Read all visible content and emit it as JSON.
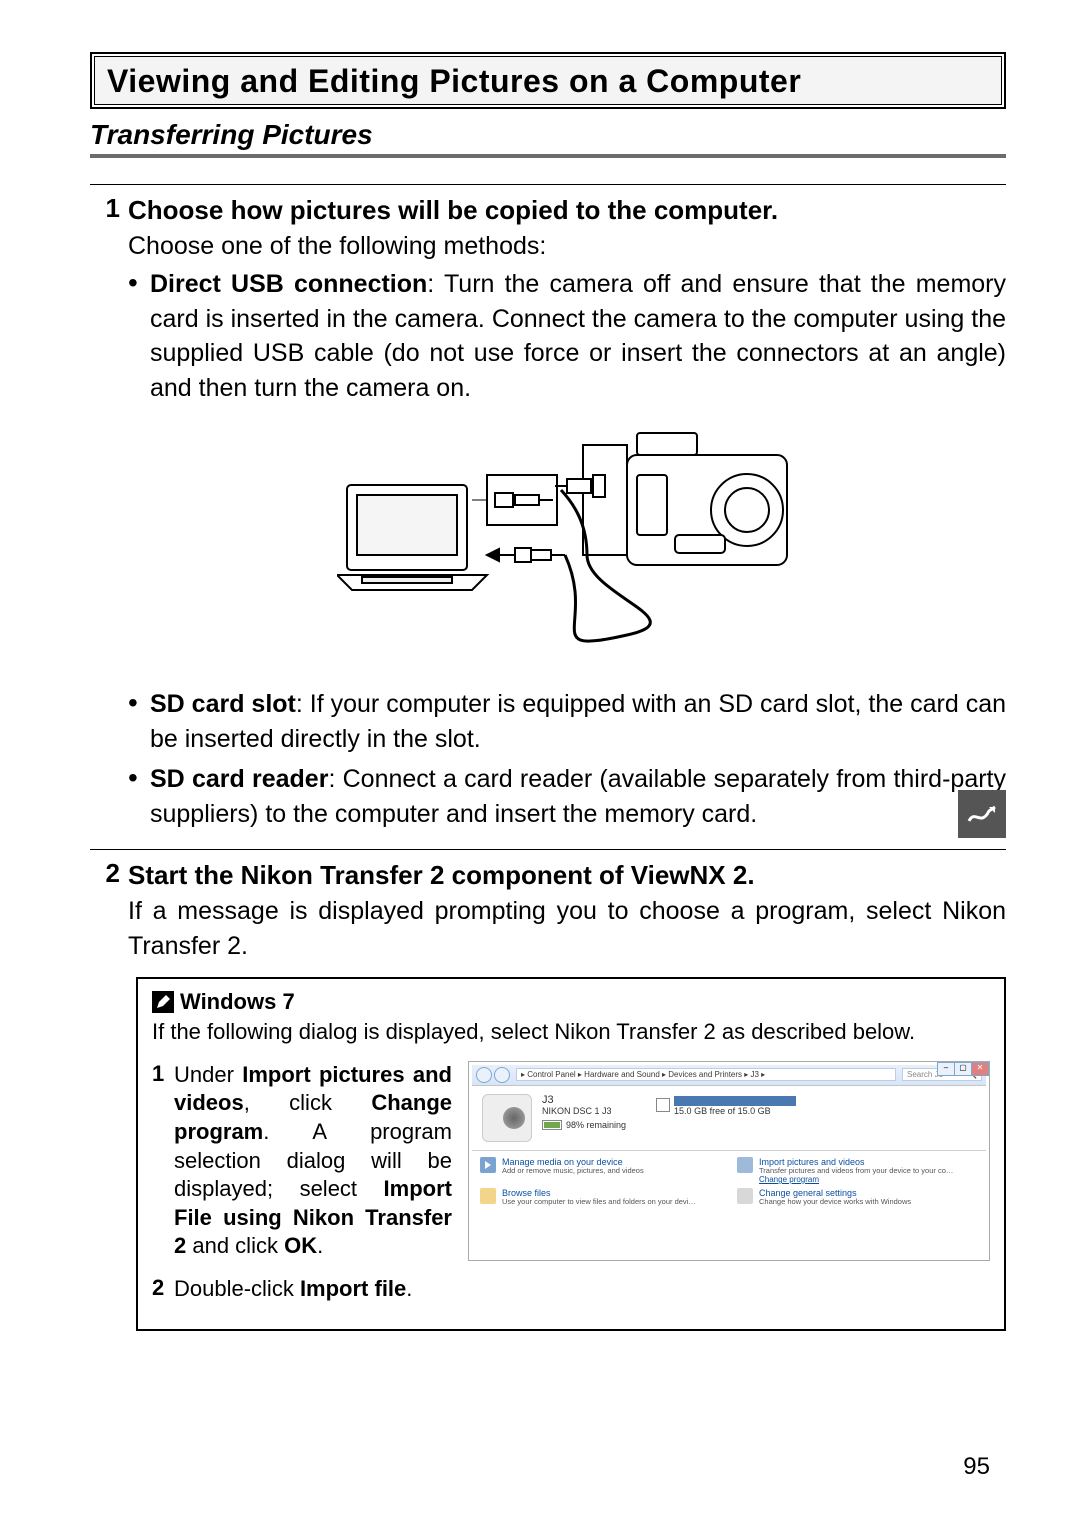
{
  "header": {
    "title": "Viewing and Editing Pictures on a Computer"
  },
  "subheader": "Transferring Pictures",
  "step1": {
    "num": "1",
    "heading": "Choose how pictures will be copied to the computer.",
    "intro": "Choose one of the following methods:",
    "b1_label": "Direct USB connection",
    "b1_text": ": Turn the camera off and ensure that the memory card is inserted in the camera. Connect the camera to the computer using the supplied USB cable (do not use force or insert the connectors at an angle) and then turn the camera on.",
    "b2_label": "SD card slot",
    "b2_text": ": If your computer is equipped with an SD card slot, the card can be inserted directly in the slot.",
    "b3_label": "SD card reader",
    "b3_text": ": Connect a card reader (available separately from third-party suppliers) to the computer and insert the memory card."
  },
  "step2": {
    "num": "2",
    "heading": "Start the Nikon Transfer 2 component of ViewNX 2.",
    "text": "If a message is displayed prompting you to choose a program, select Nikon Transfer 2."
  },
  "note": {
    "title": "Windows 7",
    "intro": "If the following dialog is displayed, select Nikon Transfer 2 as described below.",
    "s1_num": "1",
    "s1_a": "Under ",
    "s1_b": "Import pictures and videos",
    "s1_c": ", click ",
    "s1_d": "Change program",
    "s1_e": ". A program selection dialog will be displayed; select ",
    "s1_f": "Import File using Nikon Transfer 2",
    "s1_g": " and click ",
    "s1_h": "OK",
    "s1_i": ".",
    "s2_num": "2",
    "s2_a": "Double-click ",
    "s2_b": "Import file",
    "s2_c": "."
  },
  "win": {
    "breadcrumb": "▸ Control Panel ▸ Hardware and Sound ▸ Devices and Printers ▸ J3 ▸",
    "search_placeholder": "Search J3",
    "btn_min": "–",
    "btn_max": "▢",
    "btn_close": "✕",
    "device_name": "J3",
    "device_model": "NIKON DSC 1 J3",
    "battery": "98% remaining",
    "storage": "15.0 GB free of 15.0 GB",
    "act_media_t": "Manage media on your device",
    "act_media_s": "Add or remove music, pictures, and videos",
    "act_browse_t": "Browse files",
    "act_browse_s": "Use your computer to view files and folders on your devi…",
    "act_import_t": "Import pictures and videos",
    "act_import_s": "Transfer pictures and videos from your device to your co…",
    "act_import_l": "Change program",
    "act_settings_t": "Change general settings",
    "act_settings_s": "Change how your device works with Windows"
  },
  "page_number": "95"
}
